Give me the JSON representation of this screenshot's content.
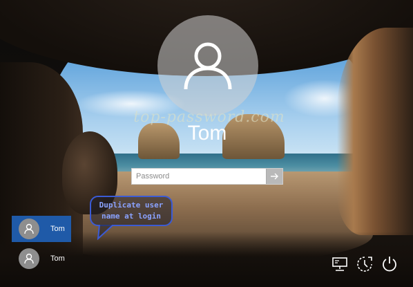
{
  "login": {
    "user_name": "Tom",
    "password_placeholder": "Password",
    "submit_icon": "arrow-right-icon"
  },
  "watermark": "top-password.com",
  "callout": {
    "line1": "Duplicate user",
    "line2": "name at login",
    "border_color": "#3b5bd6"
  },
  "user_list": [
    {
      "name": "Tom",
      "selected": true
    },
    {
      "name": "Tom",
      "selected": false
    }
  ],
  "corner_icons": [
    "network-icon",
    "ease-of-access-icon",
    "power-icon"
  ],
  "colors": {
    "selected_user_bg": "#1f5aa8",
    "password_box_bg": "#ffffff",
    "submit_button_bg": "#b9b9b9"
  }
}
